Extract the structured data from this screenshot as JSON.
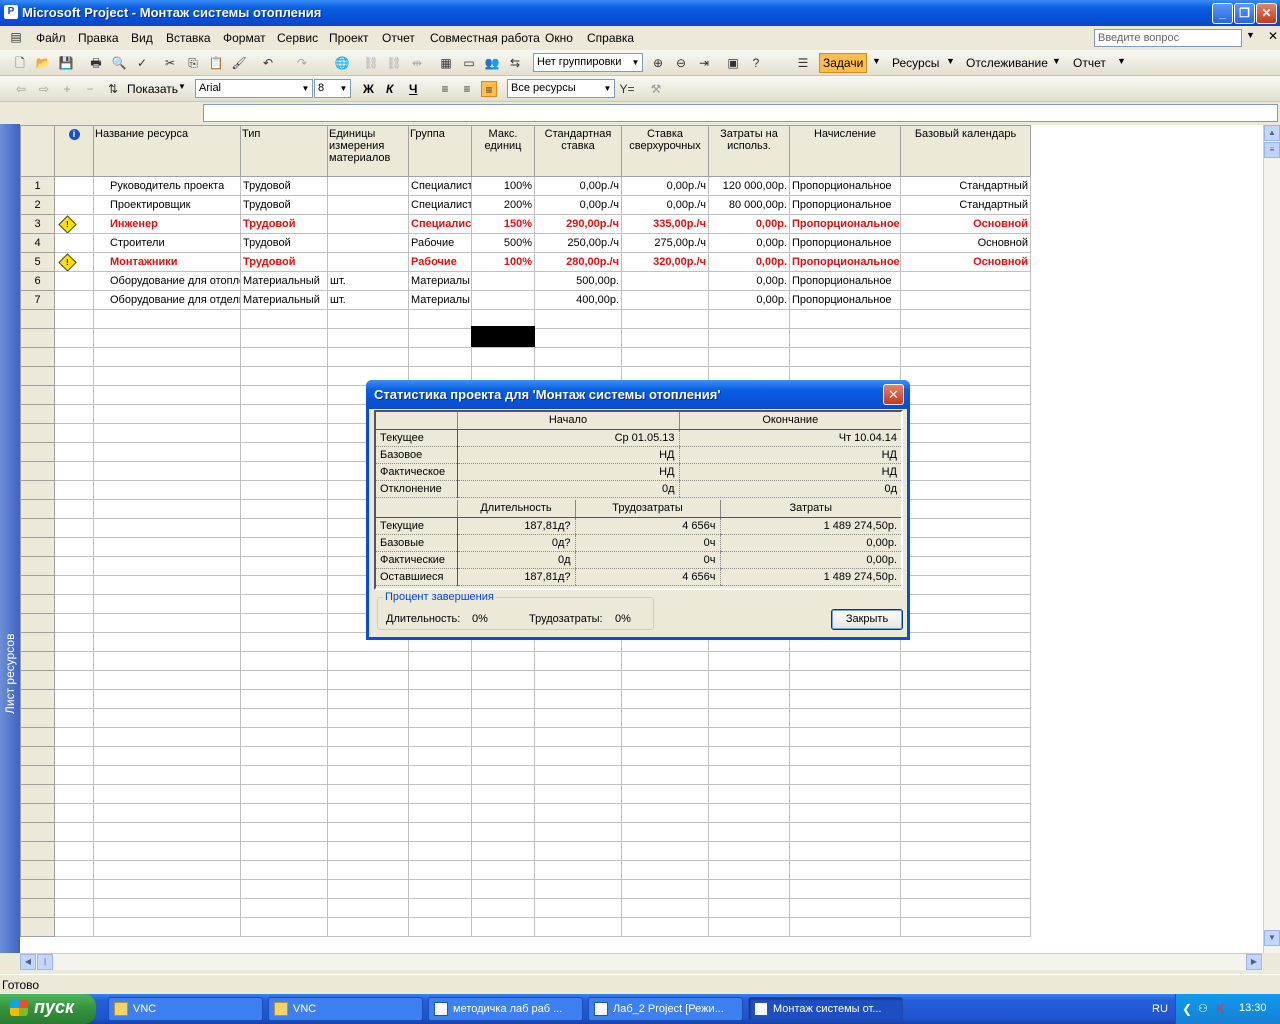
{
  "app": {
    "title": "Microsoft Project - Монтаж системы отопления"
  },
  "menu": [
    "Файл",
    "Правка",
    "Вид",
    "Вставка",
    "Формат",
    "Сервис",
    "Проект",
    "Отчет",
    "Совместная работа",
    "Окно",
    "Справка"
  ],
  "ask_placeholder": "Введите вопрос",
  "toolbar": {
    "grouping": "Нет группировки",
    "tasks": "Задачи",
    "resources": "Ресурсы",
    "tracking": "Отслеживание",
    "report": "Отчет",
    "show": "Показать",
    "font": "Arial",
    "size": "8",
    "bold": "Ж",
    "italic": "К",
    "underline": "Ч",
    "filter": "Все ресурсы"
  },
  "sidebar_label": "Лист ресурсов",
  "columns": [
    "",
    "",
    "Название ресурса",
    "Тип",
    "Единицы измерения материалов",
    "Группа",
    "Макс. единиц",
    "Стандартная ставка",
    "Ставка сверхурочных",
    "Затраты на использ.",
    "Начисление",
    "Базовый календарь"
  ],
  "rows": [
    {
      "n": "1",
      "name": "Руководитель проекта",
      "type": "Трудовой",
      "unit": "",
      "group": "Специалист",
      "max": "100%",
      "std": "0,00р./ч",
      "ovt": "0,00р./ч",
      "cost": "120 000,00р.",
      "accr": "Пропорциональное",
      "cal": "Стандартный"
    },
    {
      "n": "2",
      "name": "Проектировщик",
      "type": "Трудовой",
      "unit": "",
      "group": "Специалист",
      "max": "200%",
      "std": "0,00р./ч",
      "ovt": "0,00р./ч",
      "cost": "80 000,00р.",
      "accr": "Пропорциональное",
      "cal": "Стандартный"
    },
    {
      "n": "3",
      "name": "Инженер",
      "type": "Трудовой",
      "unit": "",
      "group": "Специалист",
      "max": "150%",
      "std": "290,00р./ч",
      "ovt": "335,00р./ч",
      "cost": "0,00р.",
      "accr": "Пропорциональное",
      "cal": "Основной"
    },
    {
      "n": "4",
      "name": "Строители",
      "type": "Трудовой",
      "unit": "",
      "group": "Рабочие",
      "max": "500%",
      "std": "250,00р./ч",
      "ovt": "275,00р./ч",
      "cost": "0,00р.",
      "accr": "Пропорциональное",
      "cal": "Основной"
    },
    {
      "n": "5",
      "name": "Монтажники",
      "type": "Трудовой",
      "unit": "",
      "group": "Рабочие",
      "max": "100%",
      "std": "280,00р./ч",
      "ovt": "320,00р./ч",
      "cost": "0,00р.",
      "accr": "Пропорциональное",
      "cal": "Основной"
    },
    {
      "n": "6",
      "name": "Оборудование для отопления",
      "type": "Материальный",
      "unit": "шт.",
      "group": "Материалы",
      "max": "",
      "std": "500,00р.",
      "ovt": "",
      "cost": "0,00р.",
      "accr": "Пропорциональное",
      "cal": ""
    },
    {
      "n": "7",
      "name": "Оборудование для отделки",
      "type": "Материальный",
      "unit": "шт.",
      "group": "Материалы",
      "max": "",
      "std": "400,00р.",
      "ovt": "",
      "cost": "0,00р.",
      "accr": "Пропорциональное",
      "cal": ""
    }
  ],
  "dialog": {
    "title": "Статистика проекта для 'Монтаж системы отопления'",
    "top_headers": [
      "Начало",
      "Окончание"
    ],
    "top_rows": [
      {
        "label": "Текущее",
        "start": "Ср 01.05.13",
        "finish": "Чт 10.04.14"
      },
      {
        "label": "Базовое",
        "start": "НД",
        "finish": "НД"
      },
      {
        "label": "Фактическое",
        "start": "НД",
        "finish": "НД"
      },
      {
        "label": "Отклонение",
        "start": "0д",
        "finish": "0д"
      }
    ],
    "bottom_headers": [
      "Длительность",
      "Трудозатраты",
      "Затраты"
    ],
    "bottom_rows": [
      {
        "label": "Текущие",
        "dur": "187,81д?",
        "work": "4 656ч",
        "cost": "1 489 274,50р."
      },
      {
        "label": "Базовые",
        "dur": "0д?",
        "work": "0ч",
        "cost": "0,00р."
      },
      {
        "label": "Фактические",
        "dur": "0д",
        "work": "0ч",
        "cost": "0,00р."
      },
      {
        "label": "Оставшиеся",
        "dur": "187,81д?",
        "work": "4 656ч",
        "cost": "1 489 274,50р."
      }
    ],
    "percent_group": "Процент завершения",
    "dur_label": "Длительность:",
    "dur_value": "0%",
    "work_label": "Трудозатраты:",
    "work_value": "0%",
    "close": "Закрыть"
  },
  "status": "Готово",
  "taskbar": {
    "start": "пуск",
    "items": [
      "VNC",
      "VNC",
      "методичка лаб раб ...",
      "Лаб_2 Project [Режи...",
      "Монтаж системы от..."
    ],
    "lang": "RU",
    "clock": "13:30"
  }
}
